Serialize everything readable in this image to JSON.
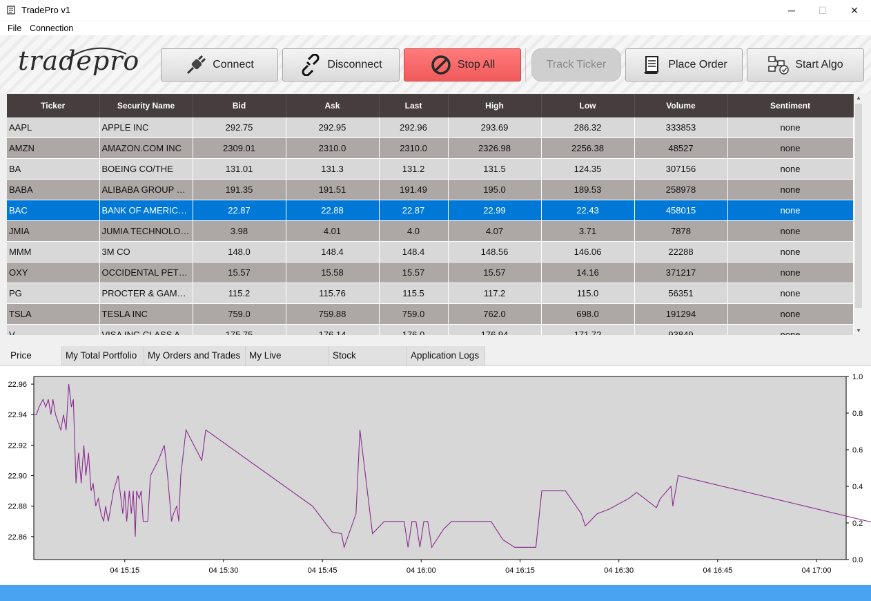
{
  "window": {
    "title": "TradePro v1",
    "minimize": "─",
    "maximize": "☐",
    "close": "✕"
  },
  "menu": [
    "File",
    "Connection"
  ],
  "logo": {
    "text": "tradepro"
  },
  "toolbar": {
    "connect": "Connect",
    "disconnect": "Disconnect",
    "stop_all": "Stop All",
    "track_ticker": "Track Ticker",
    "place_order": "Place Order",
    "start_algo": "Start Algo"
  },
  "table": {
    "columns": [
      "Ticker",
      "Security Name",
      "Bid",
      "Ask",
      "Last",
      "High",
      "Low",
      "Volume",
      "Sentiment"
    ],
    "selected_row": 4,
    "rows": [
      [
        "AAPL",
        "APPLE INC",
        "292.75",
        "292.95",
        "292.96",
        "293.69",
        "286.32",
        "333853",
        "none"
      ],
      [
        "AMZN",
        "AMAZON.COM INC",
        "2309.01",
        "2310.0",
        "2310.0",
        "2326.98",
        "2256.38",
        "48527",
        "none"
      ],
      [
        "BA",
        "BOEING CO/THE",
        "131.01",
        "131.3",
        "131.2",
        "131.5",
        "124.35",
        "307156",
        "none"
      ],
      [
        "BABA",
        "ALIBABA GROUP HO...",
        "191.35",
        "191.51",
        "191.49",
        "195.0",
        "189.53",
        "258978",
        "none"
      ],
      [
        "BAC",
        "BANK OF AMERICA ...",
        "22.87",
        "22.88",
        "22.87",
        "22.99",
        "22.43",
        "458015",
        "none"
      ],
      [
        "JMIA",
        "JUMIA TECHNOLOG...",
        "3.98",
        "4.01",
        "4.0",
        "4.07",
        "3.71",
        "7878",
        "none"
      ],
      [
        "MMM",
        "3M CO",
        "148.0",
        "148.4",
        "148.4",
        "148.56",
        "146.06",
        "22288",
        "none"
      ],
      [
        "OXY",
        "OCCIDENTAL PETRO...",
        "15.57",
        "15.58",
        "15.57",
        "15.57",
        "14.16",
        "371217",
        "none"
      ],
      [
        "PG",
        "PROCTER & GAMBL...",
        "115.2",
        "115.76",
        "115.5",
        "117.2",
        "115.0",
        "56351",
        "none"
      ],
      [
        "TSLA",
        "TESLA INC",
        "759.0",
        "759.88",
        "759.0",
        "762.0",
        "698.0",
        "191294",
        "none"
      ],
      [
        "V",
        "VISA INC-CLASS A S...",
        "175.75",
        "176.14",
        "176.0",
        "176.94",
        "171.72",
        "93849",
        "none"
      ]
    ]
  },
  "tabs": [
    "Price Charts",
    "My Total Portfolio",
    "My Orders and Trades",
    "My Live Strategies",
    "Stock Sentiments",
    "Application Logs"
  ],
  "active_tab": 0,
  "colors": {
    "header": "#453d3e",
    "row_odd": "#d8d8d8",
    "row_even": "#ada7a6",
    "selected": "#0078d7",
    "stop": "#f05a5a",
    "line": "#8b2a8f",
    "plot_bg": "#d7d7d7"
  },
  "chart_data": {
    "type": "line",
    "title": "",
    "xlabel": "",
    "ylabel": "",
    "x_ticks": [
      "04 15:15",
      "04 15:30",
      "04 15:45",
      "04 16:00",
      "04 16:15",
      "04 16:30",
      "04 16:45",
      "04 17:00"
    ],
    "y_ticks": [
      "22.86",
      "22.88",
      "22.90",
      "22.92",
      "22.94",
      "22.96"
    ],
    "y2_ticks": [
      "0.0",
      "0.2",
      "0.4",
      "0.6",
      "0.8",
      "1.0"
    ],
    "ylim": [
      22.845,
      22.965
    ],
    "y2lim": [
      0.0,
      1.0
    ],
    "x_range_min": [
      -13.8,
      109.5
    ],
    "series": [
      {
        "points": [
          [
            -13.8,
            22.94
          ],
          [
            -13.4,
            22.94
          ],
          [
            -13.0,
            22.945
          ],
          [
            -12.4,
            22.95
          ],
          [
            -12.0,
            22.945
          ],
          [
            -11.6,
            22.95
          ],
          [
            -11.2,
            22.94
          ],
          [
            -10.9,
            22.95
          ],
          [
            -10.5,
            22.94
          ],
          [
            -10.1,
            22.935
          ],
          [
            -9.7,
            22.93
          ],
          [
            -9.3,
            22.94
          ],
          [
            -8.9,
            22.93
          ],
          [
            -8.5,
            22.96
          ],
          [
            -8.1,
            22.945
          ],
          [
            -7.8,
            22.95
          ],
          [
            -7.4,
            22.895
          ],
          [
            -7.0,
            22.915
          ],
          [
            -6.6,
            22.895
          ],
          [
            -6.2,
            22.92
          ],
          [
            -5.9,
            22.9
          ],
          [
            -5.5,
            22.915
          ],
          [
            -5.1,
            22.89
          ],
          [
            -4.8,
            22.895
          ],
          [
            -4.4,
            22.88
          ],
          [
            -4.0,
            22.885
          ],
          [
            -3.6,
            22.875
          ],
          [
            -3.2,
            22.87
          ],
          [
            -2.9,
            22.88
          ],
          [
            -2.5,
            22.87
          ],
          [
            -1.7,
            22.89
          ],
          [
            -1.0,
            22.9
          ],
          [
            -0.3,
            22.875
          ],
          [
            0.0,
            22.89
          ],
          [
            0.3,
            22.87
          ],
          [
            0.7,
            22.89
          ],
          [
            1.0,
            22.875
          ],
          [
            1.3,
            22.89
          ],
          [
            1.6,
            22.86
          ],
          [
            1.8,
            22.89
          ],
          [
            2.2,
            22.885
          ],
          [
            2.5,
            22.89
          ],
          [
            2.8,
            22.87
          ],
          [
            3.5,
            22.87
          ],
          [
            3.9,
            22.9
          ],
          [
            5.1,
            22.91
          ],
          [
            6.0,
            22.92
          ],
          [
            6.5,
            22.9
          ],
          [
            7.1,
            22.87
          ],
          [
            7.4,
            22.875
          ],
          [
            7.9,
            22.88
          ],
          [
            8.2,
            22.87
          ],
          [
            8.5,
            22.9
          ],
          [
            9.3,
            22.93
          ],
          [
            11.7,
            22.91
          ],
          [
            12.3,
            22.93
          ],
          [
            28.5,
            22.88
          ],
          [
            31.5,
            22.863
          ],
          [
            32.9,
            22.862
          ],
          [
            33.3,
            22.853
          ],
          [
            35.1,
            22.875
          ],
          [
            35.7,
            22.93
          ],
          [
            37.6,
            22.862
          ],
          [
            39.4,
            22.87
          ],
          [
            41.2,
            22.87
          ],
          [
            42.4,
            22.87
          ],
          [
            43.0,
            22.853
          ],
          [
            43.6,
            22.87
          ],
          [
            44.2,
            22.87
          ],
          [
            44.8,
            22.853
          ],
          [
            45.4,
            22.87
          ],
          [
            46.0,
            22.87
          ],
          [
            46.6,
            22.853
          ],
          [
            48.4,
            22.865
          ],
          [
            49.6,
            22.87
          ],
          [
            55.6,
            22.87
          ],
          [
            57.4,
            22.858
          ],
          [
            59.2,
            22.853
          ],
          [
            61.4,
            22.853
          ],
          [
            62.4,
            22.853
          ],
          [
            63.3,
            22.89
          ],
          [
            66.9,
            22.89
          ],
          [
            69.3,
            22.875
          ],
          [
            69.9,
            22.867
          ],
          [
            71.7,
            22.875
          ],
          [
            73.5,
            22.878
          ],
          [
            76.5,
            22.885
          ],
          [
            77.7,
            22.889
          ],
          [
            80.7,
            22.879
          ],
          [
            81.3,
            22.885
          ],
          [
            82.9,
            22.893
          ],
          [
            83.2,
            22.88
          ],
          [
            84.0,
            22.9
          ],
          [
            114.8,
            22.868
          ],
          [
            116.0,
            22.858
          ],
          [
            116.6,
            22.867
          ],
          [
            131.0,
            22.867
          ],
          [
            131.3,
            22.879
          ],
          [
            132.5,
            22.868
          ]
        ]
      }
    ]
  }
}
